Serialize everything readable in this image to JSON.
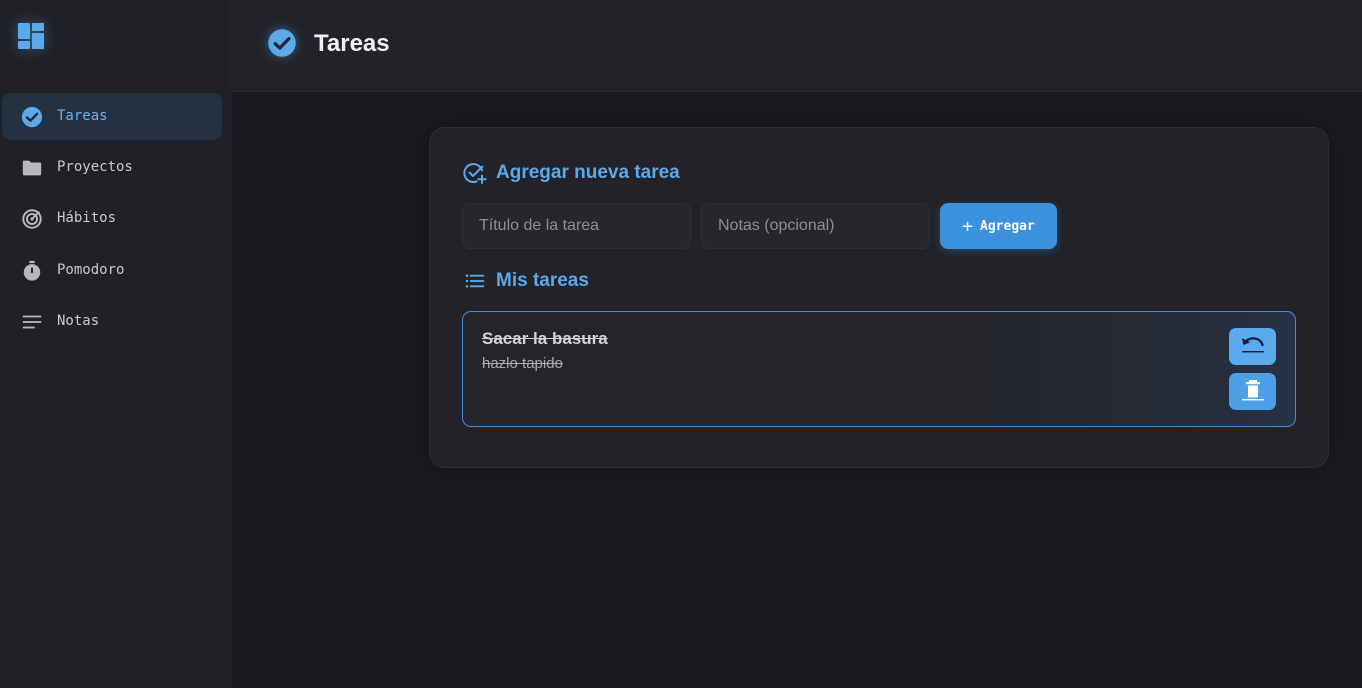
{
  "colors": {
    "accent": "#5aa9ea",
    "button": "#3b91dc",
    "background": "#1b1b1f",
    "sidebar": "#202127",
    "active_nav_bg": "#243140"
  },
  "sidebar": {
    "logo_icon": "dashboard-icon",
    "items": [
      {
        "label": "Tareas",
        "icon": "check-circle-icon",
        "active": true
      },
      {
        "label": "Proyectos",
        "icon": "folder-icon",
        "active": false
      },
      {
        "label": "Hábitos",
        "icon": "target-icon",
        "active": false
      },
      {
        "label": "Pomodoro",
        "icon": "timer-icon",
        "active": false
      },
      {
        "label": "Notas",
        "icon": "notes-icon",
        "active": false
      }
    ]
  },
  "header": {
    "title": "Tareas",
    "icon": "check-circle-icon"
  },
  "form": {
    "heading": "Agregar nueva tarea",
    "title_placeholder": "Título de la tarea",
    "title_value": "",
    "notes_placeholder": "Notas (opcional)",
    "notes_value": "",
    "add_label": "Agregar"
  },
  "list": {
    "heading": "Mis tareas",
    "tasks": [
      {
        "title": "Sacar la basura",
        "notes": "hazlo tapido",
        "completed": true,
        "undo_icon": "undo-icon",
        "delete_icon": "trash-icon"
      }
    ]
  }
}
